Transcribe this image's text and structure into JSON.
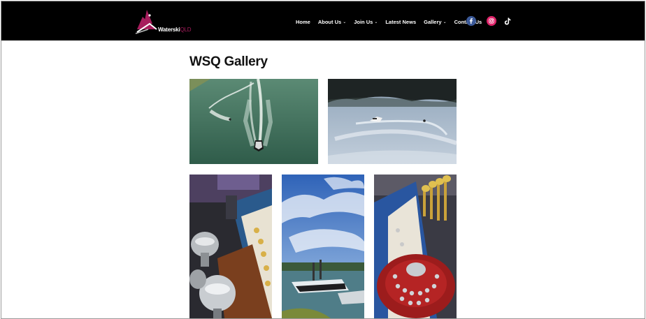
{
  "brand": {
    "name_main": "Waterski",
    "name_suffix": "QLD",
    "logo_color": "#a71d5d"
  },
  "nav": {
    "items": [
      {
        "label": "Home",
        "has_dropdown": false
      },
      {
        "label": "About Us",
        "has_dropdown": true
      },
      {
        "label": "Join Us",
        "has_dropdown": true
      },
      {
        "label": "Latest News",
        "has_dropdown": false
      },
      {
        "label": "Gallery",
        "has_dropdown": true
      },
      {
        "label": "Contact Us",
        "has_dropdown": false
      }
    ],
    "dropdown_glyph": "⌄",
    "social": [
      {
        "icon": "facebook-icon",
        "color": "#3b5998"
      },
      {
        "icon": "instagram-icon",
        "color": "#e0246a"
      },
      {
        "icon": "tiktok-icon",
        "color": "#ffffff"
      }
    ]
  },
  "page": {
    "title": "WSQ Gallery"
  },
  "gallery": {
    "photos": [
      {
        "subject": "aerial-boat-skier"
      },
      {
        "subject": "river-boat-skier"
      },
      {
        "subject": "trophy-table"
      },
      {
        "subject": "boats-at-lake"
      },
      {
        "subject": "medals-and-shield"
      }
    ]
  },
  "colors": {
    "header_bg": "#000000",
    "page_bg": "#ffffff",
    "text": "#111111"
  }
}
